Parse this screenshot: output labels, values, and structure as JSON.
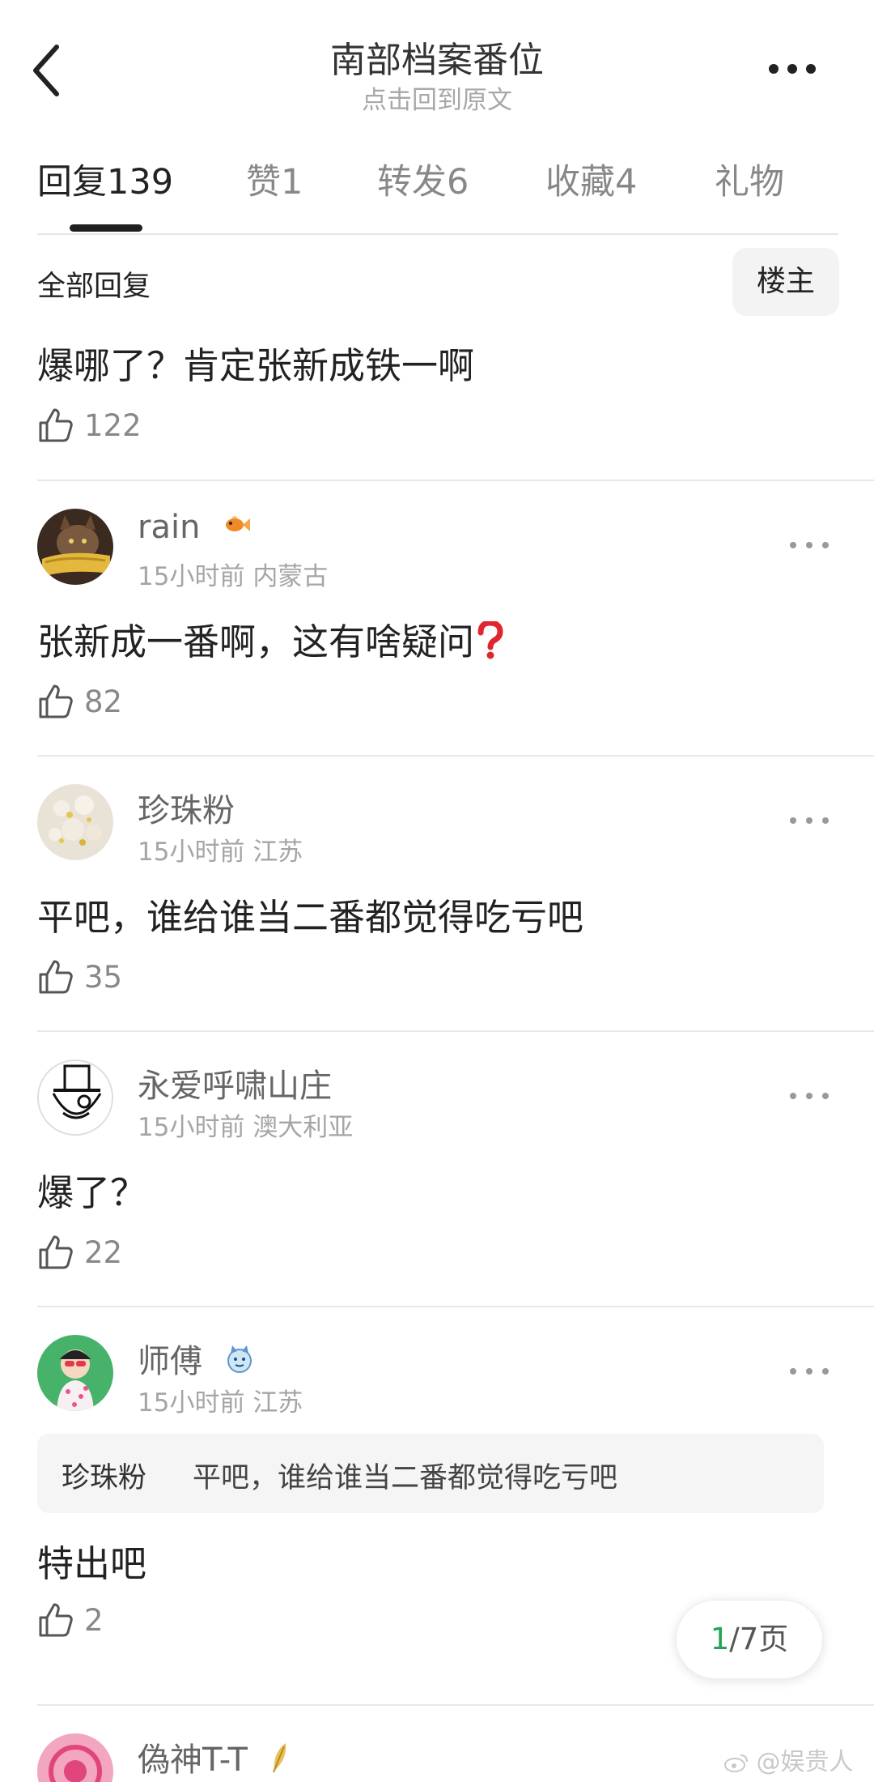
{
  "header": {
    "title": "南部档案番位",
    "subtitle": "点击回到原文"
  },
  "tabs": [
    {
      "label": "回复",
      "count": "139"
    },
    {
      "label": "赞",
      "count": "1"
    },
    {
      "label": "转发",
      "count": "6"
    },
    {
      "label": "收藏",
      "count": "4"
    },
    {
      "label": "礼物",
      "count": ""
    }
  ],
  "filter": {
    "label": "全部回复",
    "owner_button": "楼主"
  },
  "top_comment": {
    "text": "爆哪了？肯定张新成铁一啊",
    "likes": "122"
  },
  "comments": [
    {
      "user": "rain",
      "time": "15小时前",
      "location": "内蒙古",
      "text": "张新成一番啊，这有啥疑问",
      "likes": "82",
      "badge_icon": "goldfish-icon",
      "text_icon": "red-question-mark-icon"
    },
    {
      "user": "珍珠粉",
      "time": "15小时前",
      "location": "江苏",
      "text": "平吧，谁给谁当二番都觉得吃亏吧",
      "likes": "35"
    },
    {
      "user": "永爱呼啸山庄",
      "time": "15小时前",
      "location": "澳大利亚",
      "text": "爆了？",
      "likes": "22"
    },
    {
      "user": "师傅",
      "time": "15小时前",
      "location": "江苏",
      "badge_icon": "cat-badge-icon",
      "quote_user": "珍珠粉",
      "quote_text": "平吧，谁给谁当二番都觉得吃亏吧",
      "text": "特出吧",
      "likes": "2"
    },
    {
      "user": "偽神T-T",
      "badge_icon": "feather-icon"
    }
  ],
  "pagination": {
    "current": "1",
    "rest": "/7页"
  },
  "watermark": "@娱贵人",
  "colors": {
    "accent_green": "#23a455",
    "text_main": "#222222",
    "text_muted": "#a5a5a5"
  }
}
